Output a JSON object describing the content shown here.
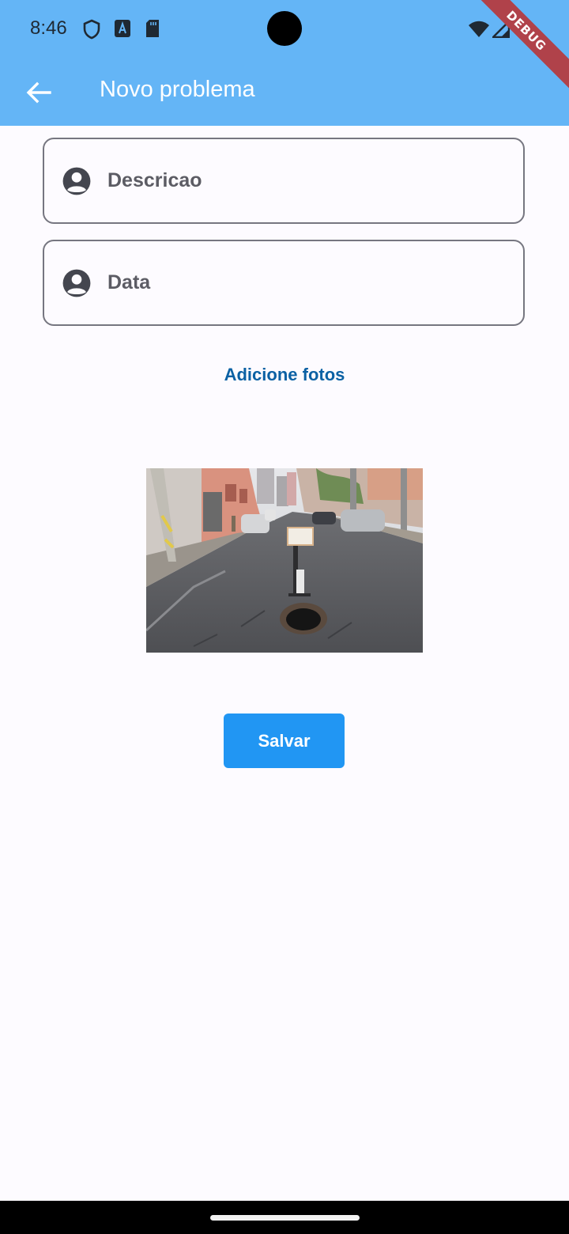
{
  "status_bar": {
    "time": "8:46",
    "left_icons": [
      "shield-icon",
      "app-a-icon",
      "sd-card-icon"
    ],
    "right_icons": [
      "wifi-icon",
      "signal-icon",
      "battery-icon"
    ]
  },
  "debug_banner": "DEBUG",
  "app_bar": {
    "back_icon": "arrow-back-icon",
    "title": "Novo problema",
    "background": "#64b5f6"
  },
  "form": {
    "fields": [
      {
        "label": "Descricao",
        "icon": "account-circle-icon"
      },
      {
        "label": "Data",
        "icon": "account-circle-icon"
      }
    ],
    "add_photos_label": "Adicione fotos",
    "photo": "street-pothole-photo",
    "save_label": "Salvar",
    "accent": "#2196f3"
  }
}
